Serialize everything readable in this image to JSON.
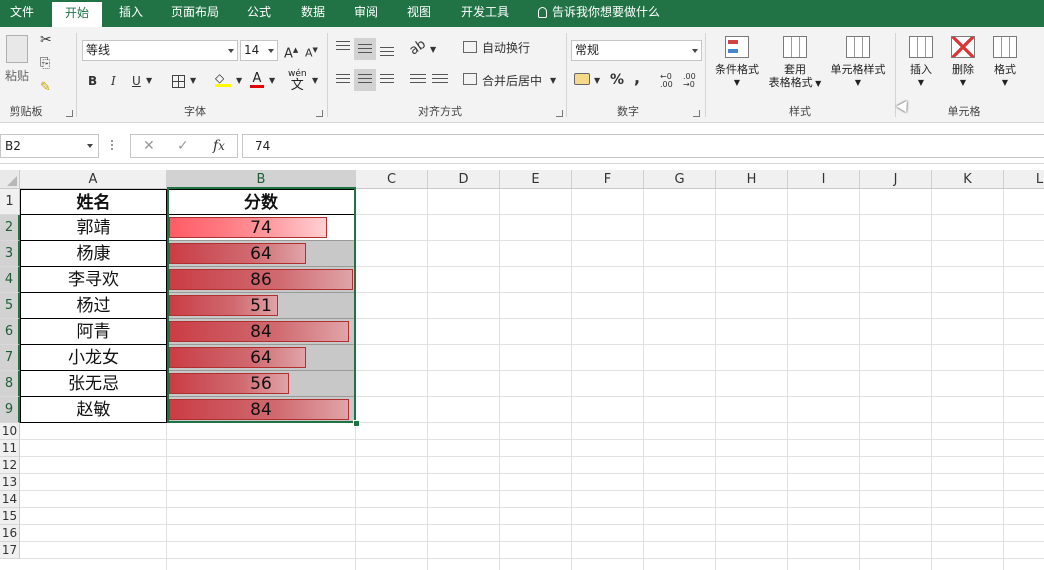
{
  "tabs": [
    {
      "label": "文件",
      "active": false
    },
    {
      "label": "开始",
      "active": true
    },
    {
      "label": "插入",
      "active": false
    },
    {
      "label": "页面布局",
      "active": false
    },
    {
      "label": "公式",
      "active": false
    },
    {
      "label": "数据",
      "active": false
    },
    {
      "label": "审阅",
      "active": false
    },
    {
      "label": "视图",
      "active": false
    },
    {
      "label": "开发工具",
      "active": false
    }
  ],
  "tell_me": "告诉我你想要做什么",
  "ribbon": {
    "clipboard": {
      "label": "剪贴板",
      "paste": "粘贴"
    },
    "font": {
      "label": "字体",
      "name": "等线",
      "size": "14",
      "bold": "B",
      "italic": "I",
      "underline": "U",
      "font_color": "A",
      "phonetic": "wén"
    },
    "alignment": {
      "label": "对齐方式",
      "wrap": "自动换行",
      "merge": "合并后居中"
    },
    "number": {
      "label": "数字",
      "format": "常规",
      "percent": "%",
      "comma": ","
    },
    "styles": {
      "label": "样式",
      "conditional": "条件格式",
      "table_line1": "套用",
      "table_line2": "表格格式",
      "cell_styles": "单元格样式"
    },
    "cells": {
      "label": "单元格",
      "insert": "插入",
      "delete": "删除",
      "format": "格式"
    }
  },
  "formula_bar": {
    "name_box": "B2",
    "formula": "74"
  },
  "columns": [
    "A",
    "B",
    "C",
    "D",
    "E",
    "F",
    "G",
    "H",
    "I",
    "J",
    "K",
    "L"
  ],
  "rows": [
    "1",
    "2",
    "3",
    "4",
    "5",
    "6",
    "7",
    "8",
    "9",
    "10",
    "11",
    "12",
    "13",
    "14",
    "15",
    "16",
    "17"
  ],
  "table": {
    "header": [
      "姓名",
      "分数"
    ],
    "records": [
      {
        "name": "郭靖",
        "score": 74
      },
      {
        "name": "杨康",
        "score": 64
      },
      {
        "name": "李寻欢",
        "score": 86
      },
      {
        "name": "杨过",
        "score": 51
      },
      {
        "name": "阿青",
        "score": 84
      },
      {
        "name": "小龙女",
        "score": 64
      },
      {
        "name": "张无忌",
        "score": 56
      },
      {
        "name": "赵敏",
        "score": 84
      }
    ],
    "databar_max": 86
  },
  "colors": {
    "accent": "#217346",
    "bar": "#cc4048",
    "bar_selected": "#ff6a73",
    "cell_fill": "#c8c8c8"
  }
}
